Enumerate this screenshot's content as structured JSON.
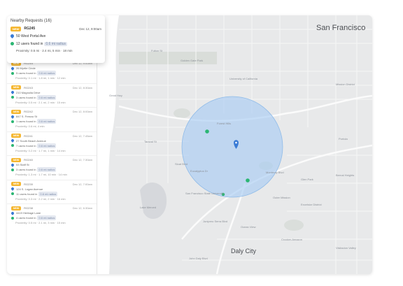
{
  "sidebar": {
    "title": "Nearby Requests (16)",
    "requests": [
      {
        "id": "RG244",
        "date": "Dec 12, 9:00am",
        "address": "26 Myrtle Circle",
        "users": "5 users found in",
        "chip": "0.6 mi radius",
        "proximity": "Proximity: 0.1 mi · 1.8 mi, 1 min · 12 min"
      },
      {
        "id": "RG243",
        "date": "Dec 12, 8:30am",
        "address": "210 Magnolia Drive",
        "users": "3 users found in",
        "chip": "0.6 mi radius",
        "proximity": "Proximity: 0.5 mi · 2.1 mi, 2 min · 15 min"
      },
      {
        "id": "RG242",
        "date": "Dec 12, 8:00am",
        "address": "847 S. Fresno St",
        "users": "1 users found in",
        "chip": "0.6 mi radius",
        "proximity": "Proximity: 0.6 mi, 4 min"
      },
      {
        "id": "RG241",
        "date": "Dec 12, 7:45am",
        "address": "27 South Beach Avenue",
        "users": "7 users found in",
        "chip": "0.6 mi radius",
        "proximity": "Proximity: 0.2 mi · 1.7 mi, 1 min · 14 min"
      },
      {
        "id": "RG240",
        "date": "Dec 12, 7:30am",
        "address": "53 Staff St",
        "users": "3 users found in",
        "chip": "0.6 mi radius",
        "proximity": "Proximity: 1.3 mi · 1.7 mi, 10 min · 14 min"
      },
      {
        "id": "RG239",
        "date": "Dec 12, 7:00am",
        "address": "124 S. Logan Avenue",
        "users": "11 users found in",
        "chip": "0.6 mi radius",
        "proximity": "Proximity: 0.3 mi · 2.2 mi, 2 min · 16 min"
      },
      {
        "id": "RG238",
        "date": "Dec 12, 6:30am",
        "address": "4419 Heritage Lane",
        "users": "4 users found in",
        "chip": "0.6 mi radius",
        "proximity": "Proximity: 0.5 mi · 2.1 mi, 3 min · 15 min"
      }
    ]
  },
  "focused": {
    "badge": "NEW",
    "id": "RG245",
    "date": "Dec 12, 9:00am",
    "address": "50 West Portal Ave",
    "users": "12 users found in",
    "chip": "0.6 mi radius",
    "proximity": "Proximity: 0.5 mi · 2.4 mi, 5 min · 18 min"
  },
  "badge_text": "NEW",
  "map": {
    "city_label": "San Francisco",
    "daly_city": "Daly City",
    "labels": [
      "Golden Gate Park",
      "University of California",
      "Fulton St",
      "Taraval St",
      "Sloat Blvd",
      "Eucalyptus Dr",
      "San Francisco State University",
      "Junipero Serra Blvd",
      "Monterey Blvd",
      "Glen Park",
      "Mission District",
      "Bernal Heights",
      "Excelsior District",
      "Crocker-Amazon",
      "Visitacion Valley",
      "Outer Mission",
      "Portola",
      "Lake Merced",
      "Great Hwy",
      "Forest Hills",
      "Ocean View",
      "John Daly Blvd"
    ]
  },
  "colors": {
    "accent": "#f5b731",
    "pin": "#3a7bd5",
    "user_dot": "#2bb673",
    "radius_fill": "#a9cdf2"
  }
}
